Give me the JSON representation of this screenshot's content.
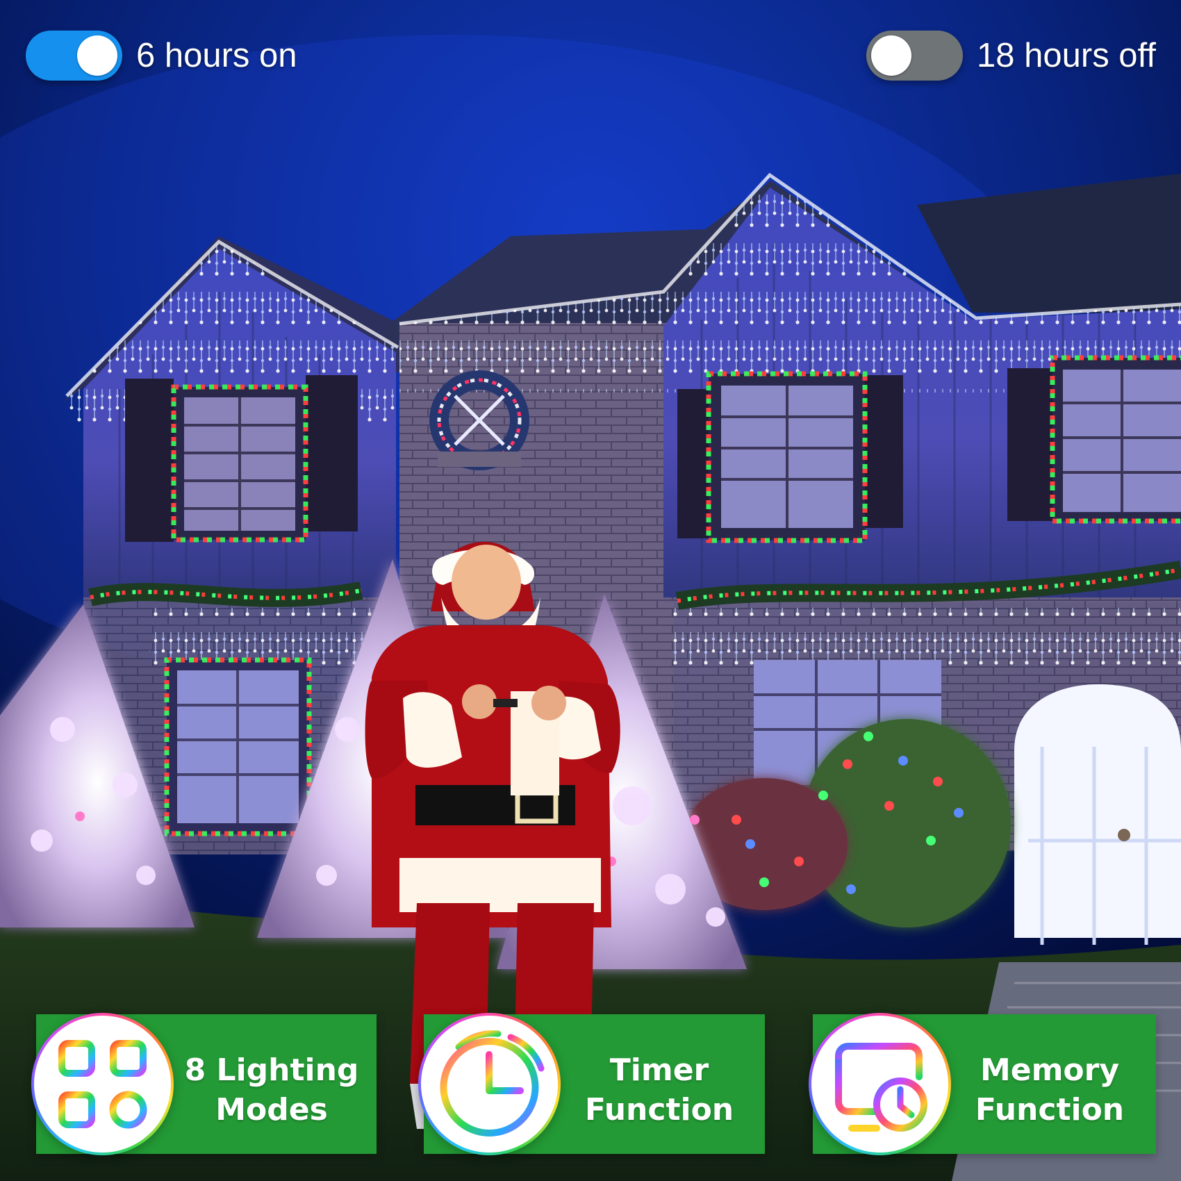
{
  "toggles": {
    "left_label": "6 hours on",
    "right_label": "18 hours off",
    "on_color": "#1590EE",
    "off_color": "#6F7477"
  },
  "features": [
    {
      "line_1": "8 Lighting",
      "line_2": "Modes",
      "icon": "four-modes-icon"
    },
    {
      "line_1": "Timer",
      "line_2": "Function",
      "icon": "timer-clock-icon"
    },
    {
      "line_1": "Memory",
      "line_2": "Function",
      "icon": "memory-screen-clock-icon"
    }
  ],
  "colors": {
    "card_green": "#239A35",
    "night_blue": "#061A6B",
    "light_blue": "#3157FF",
    "santa_red": "#A90F16"
  }
}
